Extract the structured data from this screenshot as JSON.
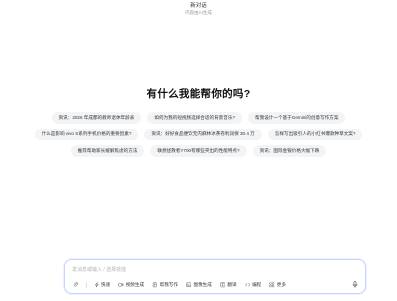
{
  "header": {
    "title": "新对话",
    "subtitle": "内容由AI生成"
  },
  "welcome": "有什么我能帮你的吗?",
  "suggestions": {
    "row1": [
      "资讯：2026 年成都的教师退休年龄表",
      "如何为我的短视频选择合适的背景音乐?",
      "帮我设计一个基于Gemini的创意写作方案"
    ],
    "row2": [
      "什么是影响 vivo S系列手机价格的重要因素?",
      "资讯：好好食品便饮无内麻林冰茶卷利润保 30.4 万",
      "怎样写出吸引人的小红书爆款种草文案?"
    ],
    "row3": [
      "推荐帮助家长缓解焦虑的方法",
      "联想拯救者Y700有哪些突出的性能特点?",
      "资讯：国际金银价格大幅下跌"
    ]
  },
  "input": {
    "placeholder": "发消息或输入 / 选择技能"
  },
  "toolbar": {
    "attach_icon": "paperclip-icon",
    "quick": "快速",
    "video": "视频生成",
    "report": "帮我写作",
    "image": "图像生成",
    "translate": "翻译",
    "code": "编程",
    "more": "更多",
    "mic_icon": "microphone-icon"
  },
  "colors": {
    "input_border": "#c8d3ff",
    "chip_bg": "#f3f4f6"
  }
}
